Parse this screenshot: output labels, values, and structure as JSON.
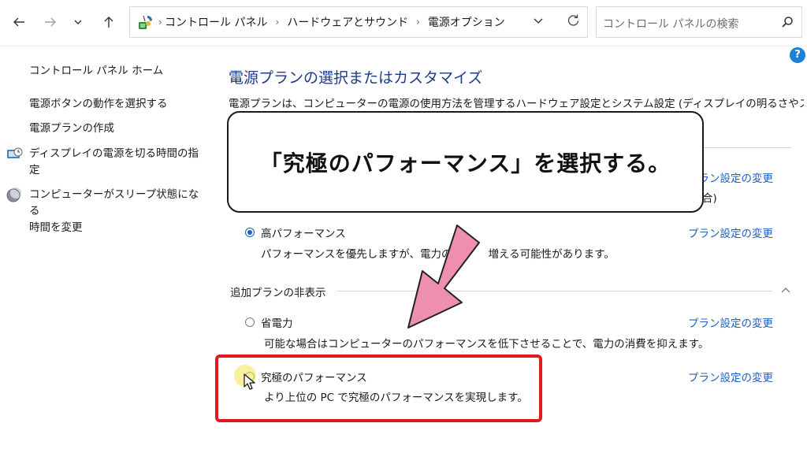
{
  "breadcrumb": {
    "items": [
      "コントロール パネル",
      "ハードウェアとサウンド",
      "電源オプション"
    ]
  },
  "search": {
    "placeholder": "コントロール パネルの検索"
  },
  "help_label": "?",
  "sidebar": {
    "home": "コントロール パネル ホーム",
    "links": [
      "電源ボタンの動作を選択する",
      "電源プランの作成",
      "ディスプレイの電源を切る時間の指定",
      "コンピューターがスリープ状態になる時間を変更"
    ],
    "link3_line1": "ディスプレイの電源を切る時間の指",
    "link3_line2": "定",
    "link4_line1": "コンピューターがスリープ状態になる",
    "link4_line2": "時間を変更"
  },
  "main": {
    "title": "電源プランの選択またはカスタマイズ",
    "description": "電源プランは、コンピューターの電源の使用方法を管理するハードウェア設定とシステム設定 (ディスプレイの明るさやスリー",
    "hidden_link": "プラン設定の変更",
    "hidden_paren": "合)",
    "plans": [
      {
        "name": "高パフォーマンス",
        "description": "パフォーマンスを優先しますが、電力の",
        "description_tail": "増える可能性があります。",
        "selected": true,
        "link": "プラン設定の変更"
      }
    ],
    "extra_section_label": "追加プランの非表示",
    "extra_plans": [
      {
        "name": "省電力",
        "description": "可能な場合はコンピューターのパフォーマンスを低下させることで、電力の消費を抑えます。",
        "selected": false,
        "link": "プラン設定の変更"
      },
      {
        "name": "究極のパフォーマンス",
        "description": "より上位の PC で究極のパフォーマンスを実現します。",
        "selected": false,
        "link": "プラン設定の変更"
      }
    ]
  },
  "annotation": {
    "callout_text": "「究極のパフォーマンス」を選択する。",
    "arrow_color": "#ee8fae",
    "highlight_color": "#e0191e"
  },
  "icons": {
    "back": "arrow-left-icon",
    "forward": "arrow-right-icon",
    "recent": "chevron-down-icon",
    "up": "arrow-up-icon",
    "control_panel": "control-panel-icon",
    "refresh": "refresh-icon",
    "search": "search-icon",
    "display_clock": "display-clock-icon",
    "sleep_moon": "sleep-moon-icon",
    "cursor": "mouse-pointer-icon"
  }
}
